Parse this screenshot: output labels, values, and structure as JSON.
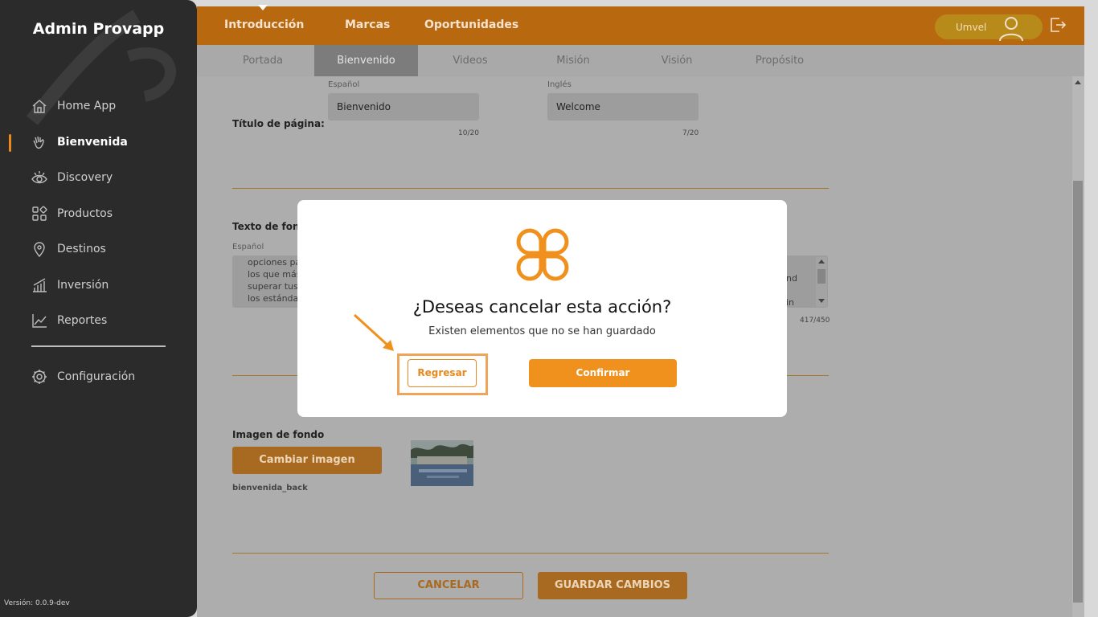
{
  "sidebar": {
    "brand": "Admin Provapp",
    "items": [
      {
        "label": "Home App",
        "icon": "home-icon"
      },
      {
        "label": "Bienvenida",
        "icon": "hand-icon"
      },
      {
        "label": "Discovery",
        "icon": "eye-icon"
      },
      {
        "label": "Productos",
        "icon": "grid-icon"
      },
      {
        "label": "Destinos",
        "icon": "location-pin-icon"
      },
      {
        "label": "Inversión",
        "icon": "bar-chart-icon"
      },
      {
        "label": "Reportes",
        "icon": "line-chart-icon"
      }
    ],
    "config_label": "Configuración",
    "version": "Versión: 0.0.9-dev"
  },
  "topbar": {
    "tabs": [
      "Introducción",
      "Marcas",
      "Oportunidades"
    ],
    "user": "Umvel"
  },
  "subtabs": [
    "Portada",
    "Bienvenido",
    "Videos",
    "Misión",
    "Visión",
    "Propósito"
  ],
  "form": {
    "lang_es": "Español",
    "lang_en": "Inglés",
    "title_label": "Título de página:",
    "title_es": "Bienvenido",
    "title_en": "Welcome",
    "title_es_count": "10/20",
    "title_en_count": "7/20",
    "bg_text_label": "Texto de fondo",
    "bg_text_es_lines": [
      "opciones pa",
      "los que más",
      "superar tus",
      "los estánda"
    ],
    "bg_text_en_frag1": "nd",
    "bg_text_en_frag2": "in",
    "bg_text_count": "417/450",
    "bg_image_label": "Imagen de fondo",
    "change_image_btn": "Cambiar imagen",
    "image_name": "bienvenida_back",
    "cancel_btn": "CANCELAR",
    "save_btn": "GUARDAR CAMBIOS"
  },
  "modal": {
    "title": "¿Deseas cancelar esta acción?",
    "message": "Existen elementos que no se han guardado",
    "back_btn": "Regresar",
    "confirm_btn": "Confirmar"
  },
  "colors": {
    "accent": "#f0911e",
    "topbar": "#b8690f",
    "sidebar": "#2b2b2b"
  }
}
